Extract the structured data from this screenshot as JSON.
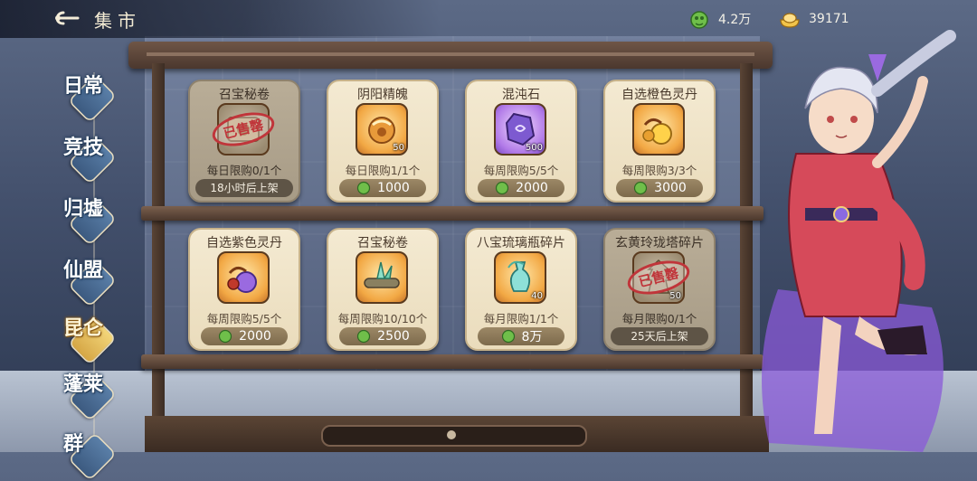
{
  "header": {
    "title": "集市"
  },
  "currencies": [
    {
      "name": "jade-currency",
      "value": "4.2万"
    },
    {
      "name": "gold-ingot-currency",
      "value": "39171"
    }
  ],
  "sidebar": {
    "items": [
      {
        "label": "日常",
        "active": false
      },
      {
        "label": "竞技",
        "active": false
      },
      {
        "label": "归墟",
        "active": false
      },
      {
        "label": "仙盟",
        "active": false
      },
      {
        "label": "昆仑",
        "active": true
      },
      {
        "label": "蓬莱",
        "active": false
      },
      {
        "label": "群",
        "active": false
      }
    ]
  },
  "shop": {
    "row1": [
      {
        "name": "召宝秘卷",
        "limit": "每日限购0/1个",
        "sold": true,
        "stamp": "已售罄",
        "restock": "18小时后上架"
      },
      {
        "name": "阴阳精魄",
        "limit": "每日限购1/1个",
        "count": "50",
        "price": "1000"
      },
      {
        "name": "混沌石",
        "limit": "每周限购5/5个",
        "count": "500",
        "price": "2000"
      },
      {
        "name": "自选橙色灵丹",
        "limit": "每周限购3/3个",
        "price": "3000"
      }
    ],
    "row2": [
      {
        "name": "自选紫色灵丹",
        "limit": "每周限购5/5个",
        "price": "2000"
      },
      {
        "name": "召宝秘卷",
        "limit": "每周限购10/10个",
        "price": "2500"
      },
      {
        "name": "八宝琉璃瓶碎片",
        "limit": "每月限购1/1个",
        "count": "40",
        "price": "8万"
      },
      {
        "name": "玄黄玲珑塔碎片",
        "limit": "每月限购0/1个",
        "sold": true,
        "stamp": "已售罄",
        "count": "50",
        "restock": "25天后上架"
      }
    ]
  },
  "colors": {
    "accent_gold": "#d5a645",
    "sold_red": "#c0353a",
    "price_green": "#6fbf4a"
  }
}
